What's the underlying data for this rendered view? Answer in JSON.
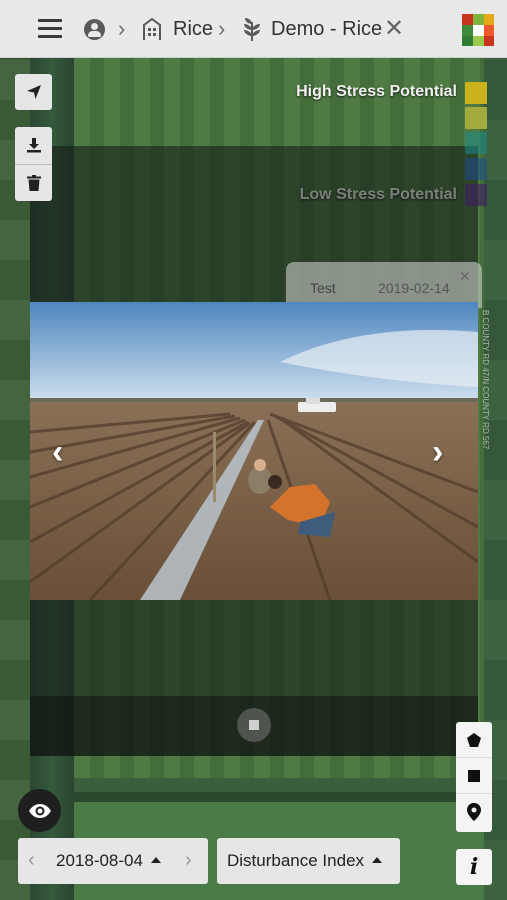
{
  "header": {
    "breadcrumb_farm": "Rice",
    "breadcrumb_field": "Demo - Rice"
  },
  "legend": {
    "high_label": "High Stress Potential",
    "low_label": "Low Stress Potential",
    "colors": [
      "#c9b21e",
      "#a3ab3e",
      "#1a8a8a",
      "#1b4a8c",
      "#3d1a66"
    ]
  },
  "observation": {
    "title": "Test",
    "date": "2019-02-14"
  },
  "map": {
    "road_label": "B COUNTY RD 47/N COUNTY RD 567"
  },
  "controls": {
    "date": "2018-08-04",
    "layer": "Disturbance Index"
  },
  "icons": {
    "menu": "menu-icon",
    "account": "account-icon",
    "farm": "farm-icon",
    "field": "plant-icon",
    "locate": "navigation-arrow-icon",
    "download": "download-icon",
    "delete": "trash-icon",
    "polygon": "polygon-icon",
    "rectangle": "rectangle-icon",
    "marker": "map-marker-icon",
    "info": "info-icon",
    "visibility": "eye-icon"
  }
}
